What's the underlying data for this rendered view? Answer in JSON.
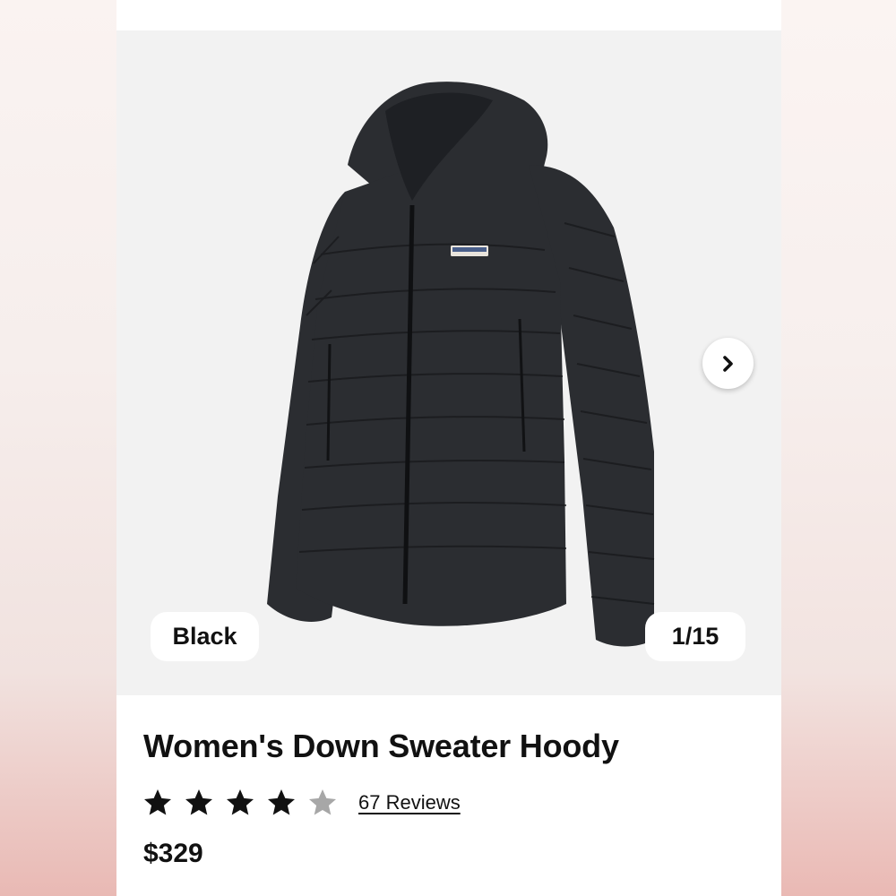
{
  "product": {
    "image_alt": "Women's Down Sweater Hoody in Black",
    "color_label": "Black",
    "image_counter": "1/15",
    "title": "Women's Down Sweater Hoody",
    "rating": 4,
    "rating_max": 5,
    "reviews_label": "67 Reviews",
    "price": "$329"
  },
  "icons": {
    "next": "chevron-right-icon",
    "star_filled": "star-filled-icon",
    "star_empty": "star-empty-icon"
  },
  "colors": {
    "gallery_bg": "#f2f2f2",
    "jacket": "#2b2d31",
    "star_filled": "#111111",
    "star_empty": "#a7a7a7",
    "text": "#111111"
  }
}
